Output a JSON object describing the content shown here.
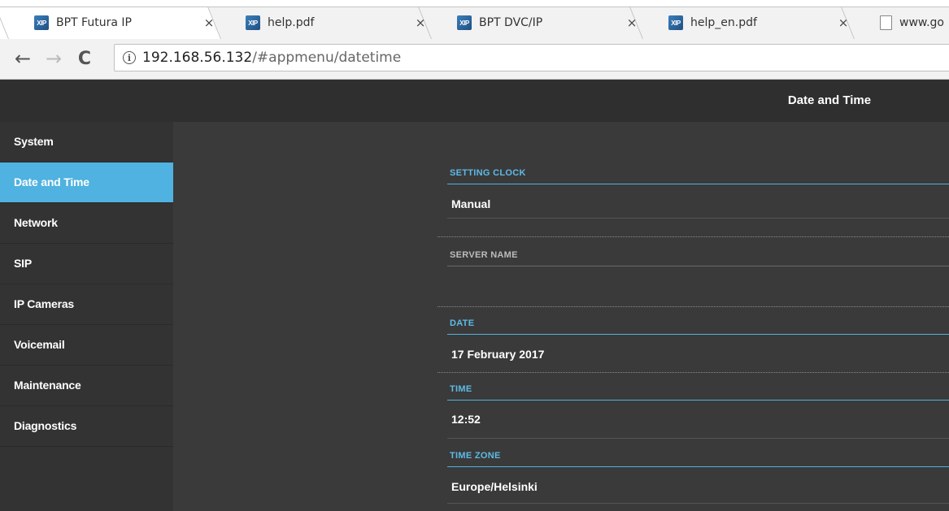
{
  "browser": {
    "tabs": [
      {
        "title": "BPT Futura IP",
        "favicon": "bpt-logo",
        "active": true
      },
      {
        "title": "help.pdf",
        "favicon": "bpt-logo",
        "active": false
      },
      {
        "title": "BPT DVC/IP",
        "favicon": "bpt-logo",
        "active": false
      },
      {
        "title": "help_en.pdf",
        "favicon": "bpt-logo",
        "active": false
      },
      {
        "title": "www.go",
        "favicon": "document-icon",
        "active": false
      }
    ],
    "favicon_text": "XIP",
    "close_glyph": "×",
    "nav": {
      "back": "←",
      "forward": "→",
      "reload": "C"
    },
    "address": {
      "host": "192.168.56.132",
      "path": "/#appmenu/datetime",
      "info_glyph": "i"
    }
  },
  "app": {
    "page_title": "Date and Time",
    "sidebar": {
      "items": [
        {
          "label": "System",
          "active": false
        },
        {
          "label": "Date and Time",
          "active": true
        },
        {
          "label": "Network",
          "active": false
        },
        {
          "label": "SIP",
          "active": false
        },
        {
          "label": "IP Cameras",
          "active": false
        },
        {
          "label": "Voicemail",
          "active": false
        },
        {
          "label": "Maintenance",
          "active": false
        },
        {
          "label": "Diagnostics",
          "active": false
        }
      ]
    },
    "fields": {
      "setting_clock": {
        "label": "SETTING CLOCK",
        "value": "Manual"
      },
      "server_name": {
        "label": "SERVER NAME",
        "value": ""
      },
      "date": {
        "label": "DATE",
        "value": "17 February 2017"
      },
      "time": {
        "label": "TIME",
        "value": "12:52"
      },
      "time_zone": {
        "label": "TIME ZONE",
        "value": "Europe/Helsinki"
      }
    },
    "colors": {
      "accent": "#4fb2e0",
      "background": "#3a3a3a",
      "sidebar": "#333333"
    }
  }
}
